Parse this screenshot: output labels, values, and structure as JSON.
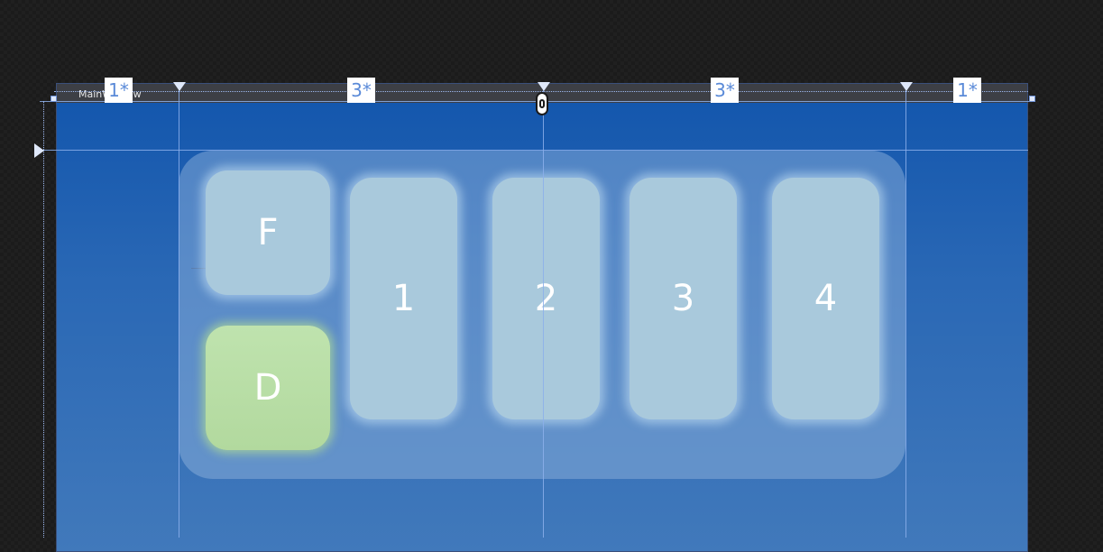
{
  "window": {
    "title": "MainWindow"
  },
  "grid": {
    "columns": [
      {
        "size_label": "1*"
      },
      {
        "size_label": "3*"
      },
      {
        "size_label": "3*"
      },
      {
        "size_label": "1*"
      }
    ]
  },
  "keys": {
    "f_label": "F",
    "d_label": "D",
    "one_label": "1",
    "two_label": "2",
    "three_label": "3",
    "four_label": "4"
  },
  "colors": {
    "window_background": "#1457ad",
    "key_fill": "#a9c9dc",
    "key_highlight": "#b8dea6",
    "guide_line": "#8cafeb",
    "badge_text": "#5a8ad8"
  },
  "icons": {
    "column_marker": "triangle-down-icon",
    "row_marker": "triangle-right-icon",
    "lock": "link-lock-icon"
  }
}
